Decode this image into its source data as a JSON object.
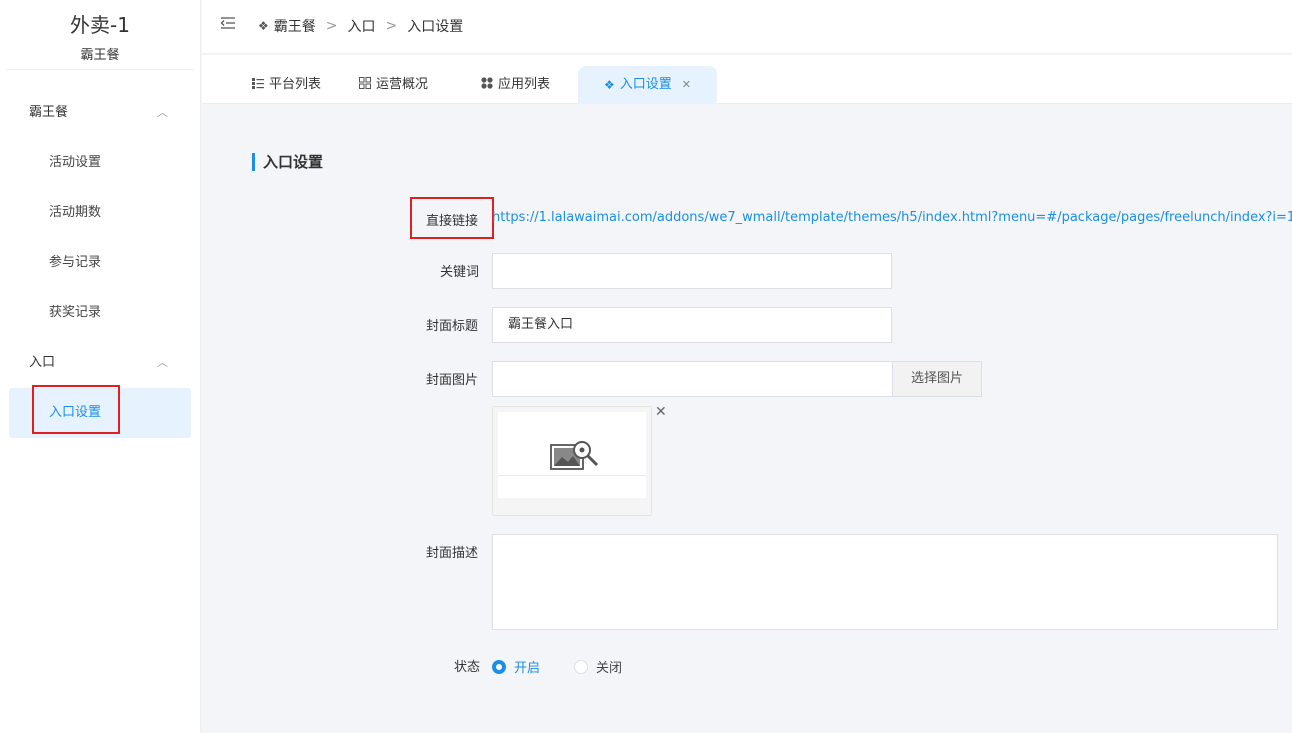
{
  "sidebar": {
    "app_title": "外卖-1",
    "app_subtitle": "霸王餐",
    "groups": [
      {
        "label": "霸王餐",
        "items": [
          "活动设置",
          "活动期数",
          "参与记录",
          "获奖记录"
        ]
      },
      {
        "label": "入口",
        "items": [
          "入口设置"
        ]
      }
    ]
  },
  "header": {
    "fold_icon": "menu-fold-icon",
    "breadcrumb": [
      "霸王餐",
      "入口",
      "入口设置"
    ]
  },
  "tabs": [
    {
      "label": "平台列表",
      "icon": "list-icon"
    },
    {
      "label": "运营概况",
      "icon": "grid-icon"
    },
    {
      "label": "应用列表",
      "icon": "apps-icon"
    },
    {
      "label": "入口设置",
      "icon": "gear-icon",
      "active": true
    }
  ],
  "form": {
    "section_title": "入口设置",
    "direct_link_label": "直接链接",
    "direct_link_value": "https://1.lalawaimai.com/addons/we7_wmall/template/themes/h5/index.html?menu=#/package/pages/freelunch/index?i=1",
    "keyword_label": "关键词",
    "keyword_value": "",
    "cover_title_label": "封面标题",
    "cover_title_value": "霸王餐入口",
    "cover_image_label": "封面图片",
    "cover_image_value": "",
    "pick_image_button": "选择图片",
    "cover_desc_label": "封面描述",
    "status_label": "状态",
    "status_on": "开启",
    "status_off": "关闭",
    "status_selected": "开启"
  },
  "colors": {
    "accent": "#1a8fe5",
    "highlight": "#e02020"
  }
}
